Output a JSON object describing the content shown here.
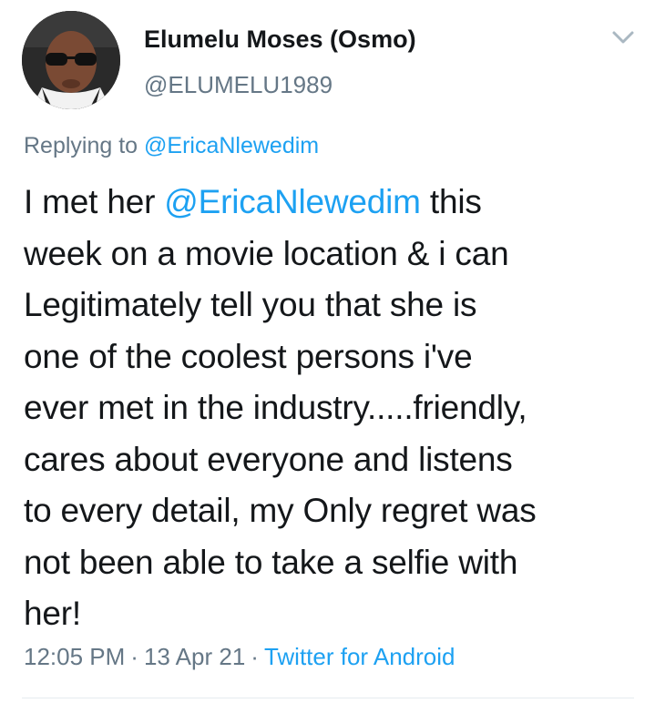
{
  "author": {
    "display_name": "Elumelu Moses (Osmo)",
    "handle": "@ELUMELU1989"
  },
  "reply_context": {
    "prefix": "Replying to",
    "mention": "@EricaNlewedim"
  },
  "tweet_body": {
    "line1_before": "I met her",
    "line1_mention": "@EricaNlewedim",
    "line1_after": "this",
    "line2": "week on a movie location & i can",
    "line3": "Legitimately tell you that she is",
    "line4": "one of the coolest persons i've",
    "line5": "ever met in the industry.....friendly,",
    "line6": "cares about everyone and listens",
    "line7": "to every detail, my Only regret was",
    "line8": "not been able to take a selfie with",
    "line9": "her!"
  },
  "meta": {
    "time": "12:05 PM",
    "separator": "·",
    "date": "13 Apr 21",
    "source": "Twitter for Android"
  },
  "icons": {
    "menu": "chevron-down-icon",
    "avatar": "avatar"
  },
  "colors": {
    "link": "#1da1f2",
    "secondary_text": "#657786",
    "primary_text": "#14171a",
    "divider": "#e6ecf0"
  }
}
